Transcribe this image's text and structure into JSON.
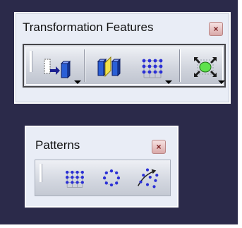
{
  "windows": [
    {
      "title": "Transformation Features",
      "close_label": "×",
      "buttons": [
        {
          "icon": "translate-rotate-icon",
          "has_dropdown": true
        },
        {
          "icon": "symmetry-icon",
          "has_dropdown": false
        },
        {
          "icon": "rectangular-pattern-icon",
          "has_dropdown": true
        },
        {
          "icon": "scaling-icon",
          "has_dropdown": true
        }
      ]
    },
    {
      "title": "Patterns",
      "close_label": "×",
      "buttons": [
        {
          "icon": "rectangular-pattern-icon"
        },
        {
          "icon": "circular-pattern-icon"
        },
        {
          "icon": "user-pattern-icon"
        }
      ]
    }
  ],
  "colors": {
    "background": "#2b2a4a",
    "pattern_dots": "#2a2fd6",
    "scaling_green": "#5fe24d"
  }
}
